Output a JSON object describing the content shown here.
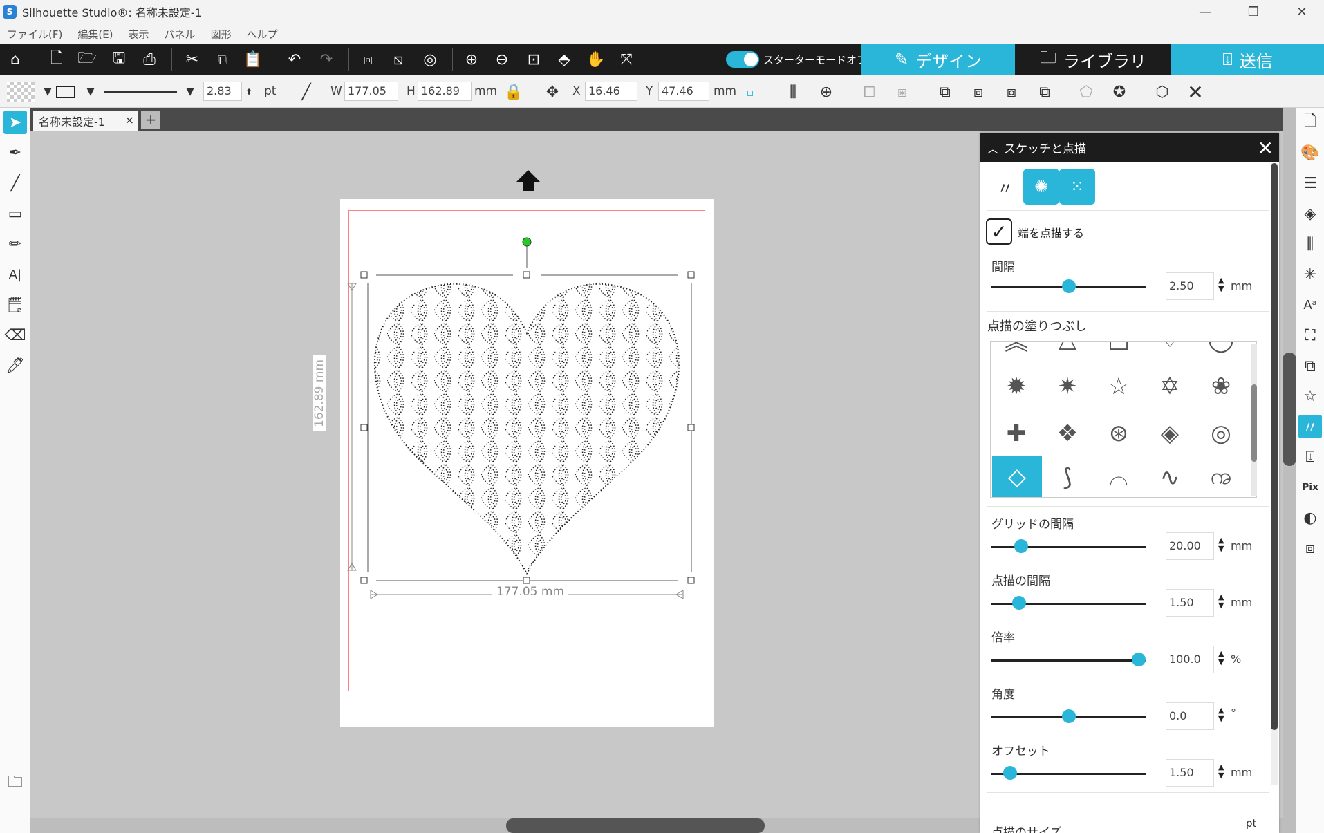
{
  "window": {
    "title": "Silhouette Studio®: 名称未設定-1",
    "minimize": "—",
    "maximize": "❐",
    "close": "✕"
  },
  "menu": [
    "ファイル(F)",
    "編集(E)",
    "表示",
    "パネル",
    "図形",
    "ヘルプ"
  ],
  "toolbar": {
    "starter_mode_label": "スターターモードオフ",
    "tabs": [
      {
        "label": "デザイン",
        "icon": "design-icon",
        "active": true
      },
      {
        "label": "ライブラリ",
        "icon": "folder-icon",
        "active": false
      },
      {
        "label": "送信",
        "icon": "send-icon",
        "active": false
      }
    ]
  },
  "props": {
    "line_width": "2.83",
    "line_unit": "pt",
    "w_label": "W",
    "w_value": "177.05",
    "h_label": "H",
    "h_value": "162.89",
    "size_unit": "mm",
    "x_label": "X",
    "x_value": "16.46",
    "y_label": "Y",
    "y_value": "47.46",
    "pos_unit": "mm"
  },
  "document": {
    "tab_title": "名称未設定-1",
    "tab_close": "×",
    "tab_add": "+",
    "width_dim": "177.05 mm",
    "height_dim": "162.89 mm"
  },
  "panel": {
    "title": "スケッチと点描",
    "close": "✕",
    "checkbox_label": "端を点描する",
    "checkbox_checked": true,
    "interval": {
      "label": "間隔",
      "value": "2.50",
      "unit": "mm",
      "level": 0.5
    },
    "fill_section_label": "点描の塗りつぶし",
    "grid_interval": {
      "label": "グリッドの間隔",
      "value": "20.00",
      "unit": "mm",
      "level": 0.19
    },
    "stipple_interval": {
      "label": "点描の間隔",
      "value": "1.50",
      "unit": "mm",
      "level": 0.18
    },
    "scale": {
      "label": "倍率",
      "value": "100.0",
      "unit": "%",
      "level": 0.95
    },
    "angle": {
      "label": "角度",
      "value": "0.0",
      "unit": "°",
      "level": 0.5
    },
    "offset": {
      "label": "オフセット",
      "value": "1.50",
      "unit": "mm",
      "level": 0.12
    },
    "truncated_label": "点描のサイズ",
    "truncated_unit": "pt"
  },
  "colors": {
    "accent": "#29b6d8",
    "toolbar_bg": "#1c1c1c",
    "cut_border": "#ff8080"
  }
}
